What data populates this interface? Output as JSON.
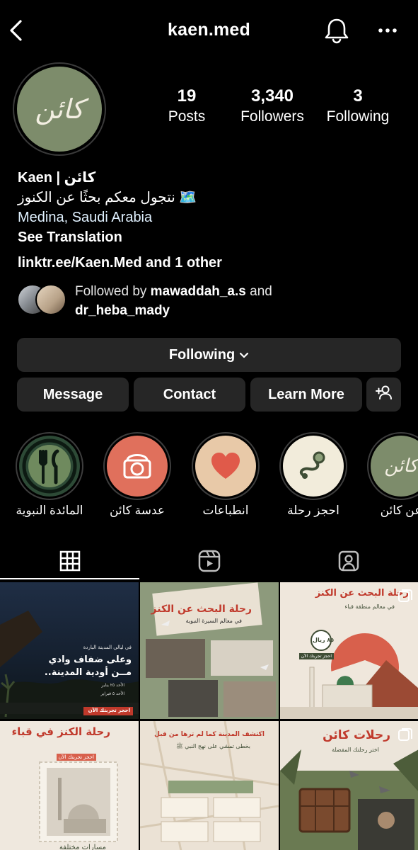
{
  "header": {
    "username": "kaen.med",
    "back_icon": "chevron-left-icon",
    "bell_icon": "bell-icon",
    "more_icon": "more-dots-icon"
  },
  "profile": {
    "avatar_text": "كائن",
    "stats": [
      {
        "value": "19",
        "label": "Posts"
      },
      {
        "value": "3,340",
        "label": "Followers"
      },
      {
        "value": "3",
        "label": "Following"
      }
    ]
  },
  "bio": {
    "name": "Kaen | كائن",
    "tagline": "نتجول معكم بحثًا عن الكنوز 🗺️",
    "location": "Medina, Saudi Arabia",
    "see_translation": "See Translation",
    "link": "linktr.ee/Kaen.Med and 1 other"
  },
  "followed_by": {
    "prefix": "Followed by",
    "user1": "mawaddah_a.s",
    "joiner": "and",
    "user2": "dr_heba_mady"
  },
  "buttons": {
    "following": "Following",
    "message": "Message",
    "contact": "Contact",
    "learn_more": "Learn More"
  },
  "highlights": [
    {
      "label": "المائدة النبوية",
      "icon": "fork-knife-icon",
      "bg": "#2d4a36"
    },
    {
      "label": "عدسة كائن",
      "icon": "camera-icon",
      "bg": "#e0705c"
    },
    {
      "label": "انطباعات",
      "icon": "heart-icon",
      "bg": "#e8c9a8"
    },
    {
      "label": "احجز رحلة",
      "icon": "map-route-icon",
      "bg": "#f2ecdb"
    },
    {
      "label": "عن كائن",
      "icon": "kaen-logo-icon",
      "bg": "#7d8c6b"
    }
  ],
  "tabs": [
    {
      "name": "grid-tab",
      "icon": "grid-icon"
    },
    {
      "name": "reels-tab",
      "icon": "reels-icon"
    },
    {
      "name": "tagged-tab",
      "icon": "tagged-person-icon"
    }
  ],
  "posts": [
    {
      "lines": [
        "وعلى ضفاف وادي",
        "مــن أودية المدينة.."
      ],
      "kicker": "في ليالي المدينة الباردة",
      "cta": "احجز تجربتك الآن",
      "schedule": [
        "الأحد ٢٥ يناير",
        "الأحد ٥ فبراير"
      ]
    },
    {
      "lines": [
        "رحلة البحث عن الكنز",
        "في معالم السيرة النبوية"
      ]
    },
    {
      "lines": [
        "رحلة البحث عن الكنز",
        "في معالم منطقة قباء"
      ],
      "price": "٨٥ ريال",
      "cta": "احجز تجربتك الآن"
    },
    {
      "lines": [
        "رحلة الكنز في قباء"
      ],
      "cta": "احجز تجربتك الآن",
      "footer": "مسارات مختلفة"
    },
    {
      "lines": [
        "اكتشف المدينة كما لم ترها من قبل",
        "بخطى تمشي على نهج النبي ﷺ"
      ]
    },
    {
      "lines": [
        "رحلات كائن",
        "اختر رحلتك المفضلة"
      ]
    }
  ],
  "colors": {
    "background": "#000000",
    "button": "#262626",
    "location": "#e0f1ff",
    "avatar": "#7d8c6b"
  }
}
